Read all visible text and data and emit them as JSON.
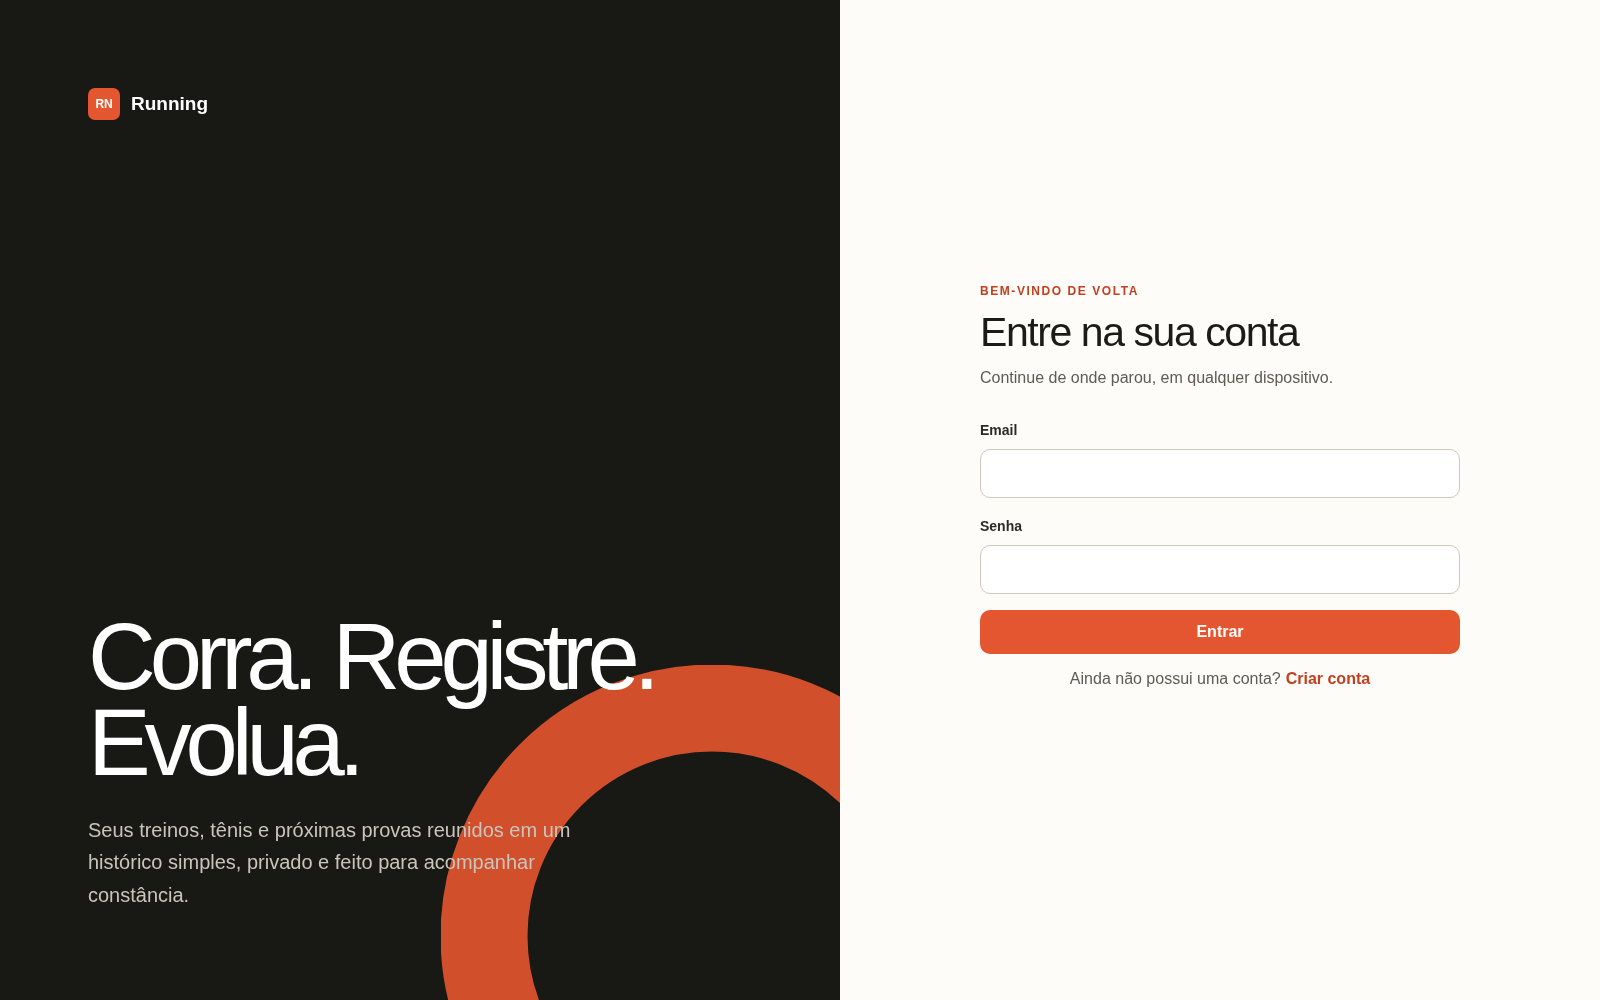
{
  "brand": {
    "badge": "RN",
    "name": "Running"
  },
  "hero": {
    "headline": "Corra. Registre. Evolua.",
    "description": "Seus treinos, tênis e próximas provas reunidos em um histórico simples, privado e feito para acompanhar constância."
  },
  "login": {
    "eyebrow": "BEM-VINDO DE VOLTA",
    "title": "Entre na sua conta",
    "subtitle": "Continue de onde parou, em qualquer dispositivo.",
    "fields": [
      {
        "label": "Email"
      },
      {
        "label": "Senha"
      }
    ],
    "submit": "Entrar",
    "signup_prompt": "Ainda não possui uma conta?",
    "signup_link": "Criar conta"
  }
}
